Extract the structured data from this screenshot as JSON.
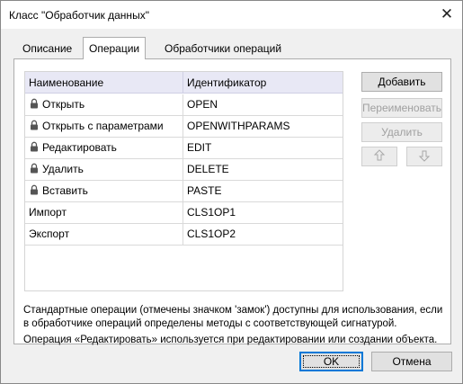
{
  "window": {
    "title": "Класс \"Обработчик данных\""
  },
  "tabs": [
    {
      "label": "Описание",
      "active": false
    },
    {
      "label": "Операции",
      "active": true
    },
    {
      "label": "Обработчики операций",
      "active": false
    }
  ],
  "table": {
    "columns": [
      "Наименование",
      "Идентификатор"
    ],
    "rows": [
      {
        "name": "Открыть",
        "id": "OPEN",
        "locked": true
      },
      {
        "name": "Открыть с параметрами",
        "id": "OPENWITHPARAMS",
        "locked": true
      },
      {
        "name": "Редактировать",
        "id": "EDIT",
        "locked": true
      },
      {
        "name": "Удалить",
        "id": "DELETE",
        "locked": true
      },
      {
        "name": "Вставить",
        "id": "PASTE",
        "locked": true
      },
      {
        "name": "Импорт",
        "id": "CLS1OP1",
        "locked": false
      },
      {
        "name": "Экспорт",
        "id": "CLS1OP2",
        "locked": false
      }
    ]
  },
  "side_buttons": {
    "add": "Добавить",
    "rename": "Переименовать",
    "delete": "Удалить",
    "up_icon": "arrow-up-icon",
    "down_icon": "arrow-down-icon"
  },
  "info": {
    "line1": "Стандартные операции (отмечены значком 'замок') доступны для использования, если в обработчике операций определены методы с соответствующей сигнатурой.",
    "line2": "Операция «Редактировать» используется при редактировании или создании объекта."
  },
  "footer": {
    "ok": "OK",
    "cancel": "Отмена"
  },
  "colors": {
    "header_bg": "#e8e8f5",
    "accent": "#0078d7",
    "disabled_text": "#a0a0a0"
  }
}
